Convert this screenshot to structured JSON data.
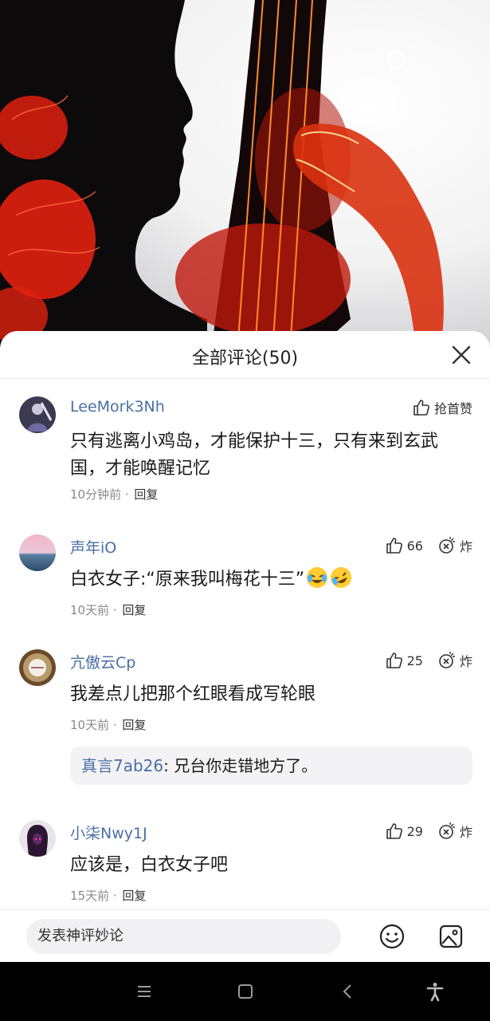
{
  "video": {
    "icons": [
      "search-icon",
      "more-vertical-icon"
    ],
    "colors": {
      "flower": "#e0200f",
      "silhouette": "#0d0a0c"
    }
  },
  "comments_panel": {
    "title": "全部评论(50)",
    "close_icon": "close-icon"
  },
  "comments": [
    {
      "username": "LeeMork3Nh",
      "text": "只有逃离小鸡岛，才能保护十三，只有来到玄武国，才能唤醒记忆",
      "time": "10分钟前",
      "reply_label": "回复",
      "like_label": "抢首赞"
    },
    {
      "username": "声年iO",
      "text": "白衣女子:“原来我叫梅花十三”",
      "time": "10天前",
      "reply_label": "回复",
      "likes": "66",
      "bomb_label": "炸",
      "emojis": [
        "crying-laughing-emoji",
        "rofl-emoji"
      ]
    },
    {
      "username": "亢傲云Cp",
      "text": "我差点儿把那个红眼看成写轮眼",
      "time": "10天前",
      "reply_label": "回复",
      "likes": "25",
      "bomb_label": "炸",
      "sub_reply": {
        "author": "真言7ab26",
        "text": ": 兄台你走错地方了。"
      }
    },
    {
      "username": "小柒Nwy1J",
      "text": "应该是，白衣女子吧",
      "time": "15天前",
      "reply_label": "回复",
      "likes": "29",
      "bomb_label": "炸"
    }
  ],
  "input_bar": {
    "placeholder": "发表神评妙论",
    "icons": [
      "emoji-icon",
      "image-icon"
    ]
  },
  "system_nav": {
    "icons": [
      "menu-icon",
      "home-icon",
      "back-icon",
      "accessibility-icon"
    ]
  },
  "colors": {
    "username": "#4a6fa5",
    "meta": "#8a8a8a",
    "sub_reply_bg": "#f3f3f5"
  }
}
